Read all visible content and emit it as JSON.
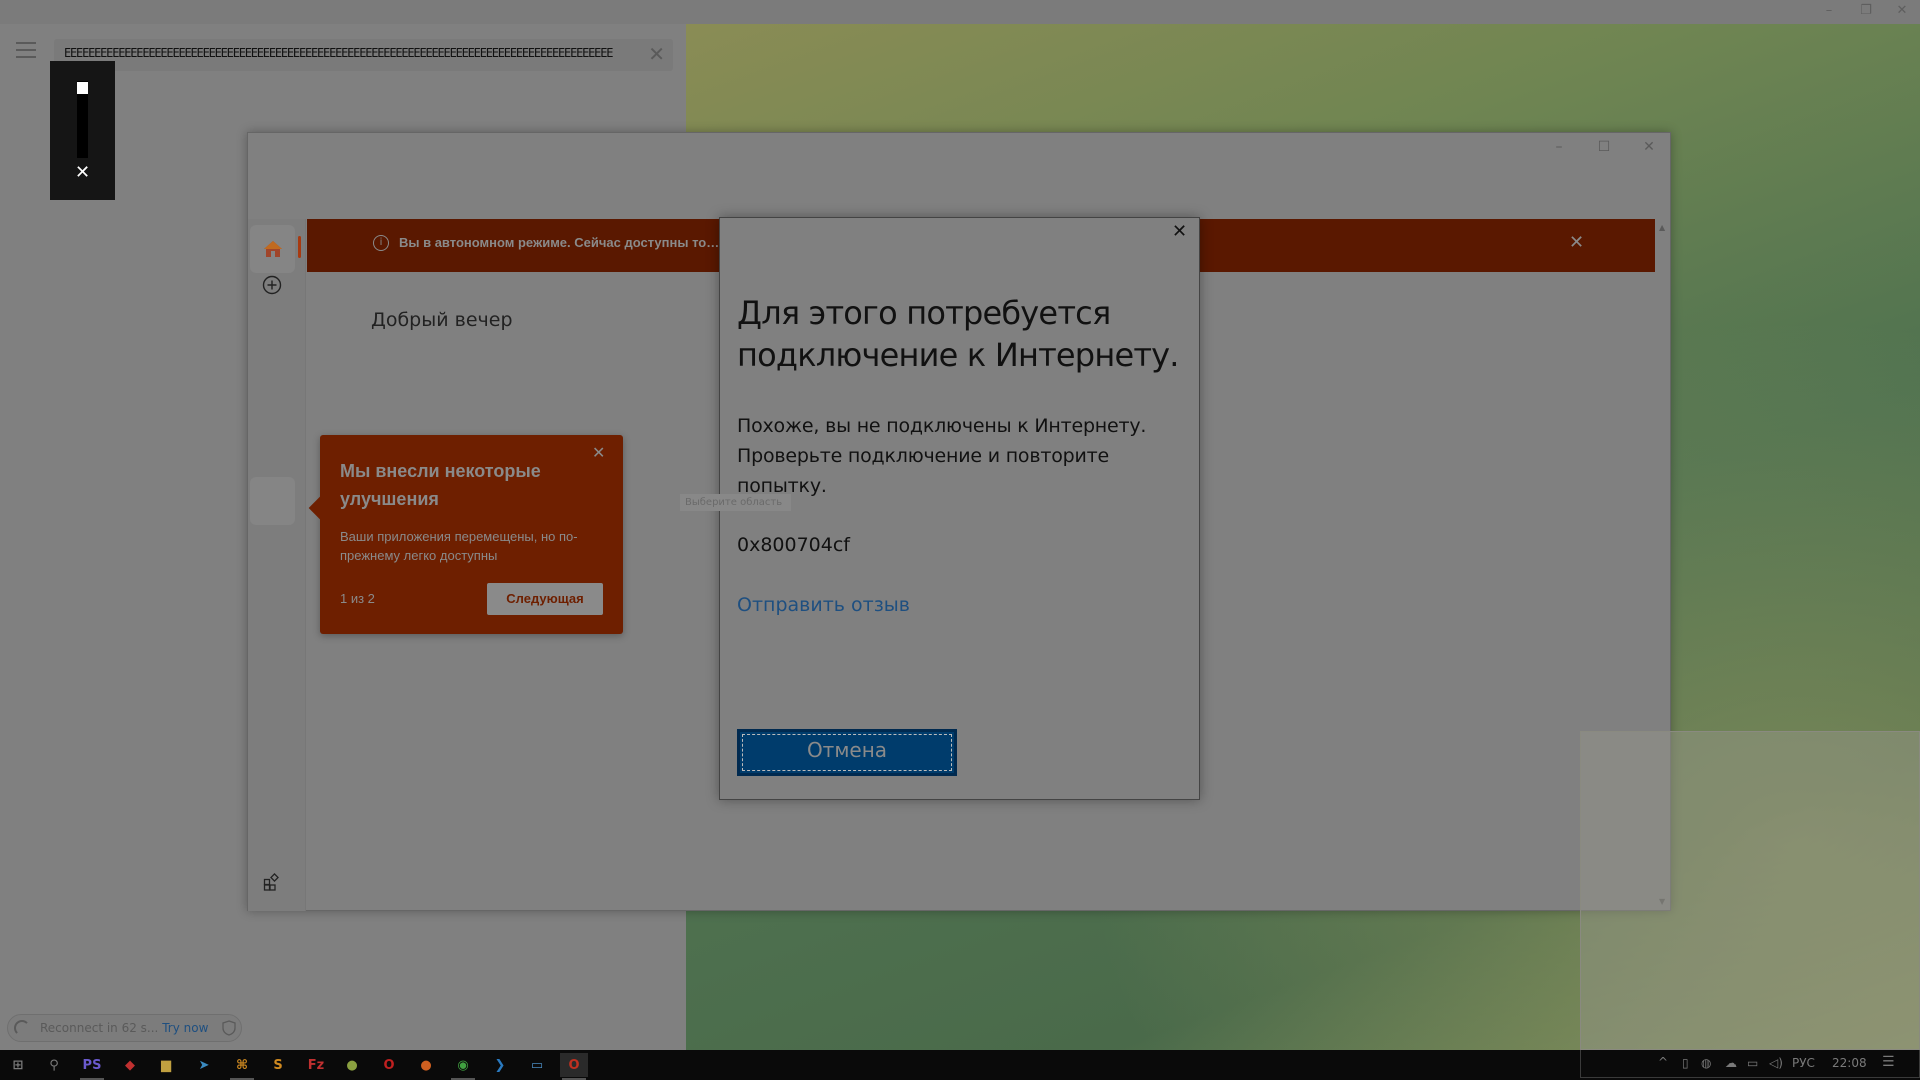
{
  "topbar": {
    "minimize": "–",
    "restore": "❐",
    "close": "✕"
  },
  "left_panel": {
    "search": {
      "value": "EEEEEEEEEEEEEEEEEEEEEEEEEEEEEEEEEEEEEEEEEEEEEEEEEEEEEEEEEEEEEEEEEEEEEEEEEEEEEEEEEEEEEEEEEEE",
      "clear": "✕"
    },
    "overlay_close": "✕",
    "reconnect": {
      "text": "Reconnect in 62 s...",
      "action": "Try now"
    }
  },
  "app_window": {
    "controls": {
      "minimize": "–",
      "maximize": "☐",
      "close": "✕"
    },
    "banner": {
      "text": "Вы в автономном режиме. Сейчас доступны то…                                                                                                       компьютере.",
      "info": "i",
      "close": "✕"
    },
    "greeting": "Добрый вечер",
    "scroll": {
      "up": "▲",
      "down": "▼"
    },
    "tooltip": {
      "title": "Мы внесли некоторые улучшения",
      "body": "Ваши приложения перемещены, но по-прежнему легко доступны",
      "counter": "1 из 2",
      "next": "Следующая",
      "close": "✕"
    },
    "accent": "#5a1800"
  },
  "area_hint": "Выберите область",
  "dialog": {
    "close": "✕",
    "title": "Для этого потребуется подключение к Интернету.",
    "body": "Похоже, вы не подключены к Интернету. Проверьте подключение и повторите попытку.",
    "error_code": "0x800704cf",
    "feedback_link": "Отправить отзыв",
    "cancel": "Отмена"
  },
  "taskbar": {
    "apps": [
      {
        "name": "start",
        "glyph": "⊞",
        "color": "#7a7a7a"
      },
      {
        "name": "search",
        "glyph": "⚲",
        "color": "#7a7a7a"
      },
      {
        "name": "phpstorm",
        "glyph": "PS",
        "color": "#6a5acd"
      },
      {
        "name": "anydesk",
        "glyph": "◆",
        "color": "#c03030"
      },
      {
        "name": "file-explorer",
        "glyph": "▆",
        "color": "#c0a040"
      },
      {
        "name": "telegram",
        "glyph": "➤",
        "color": "#3a8ac0"
      },
      {
        "name": "app-network",
        "glyph": "⌘",
        "color": "#d08a20"
      },
      {
        "name": "sublime",
        "glyph": "S",
        "color": "#d08a20"
      },
      {
        "name": "filezilla",
        "glyph": "Fz",
        "color": "#c03030"
      },
      {
        "name": "rainbow-app",
        "glyph": "●",
        "color": "#8aa040"
      },
      {
        "name": "opera",
        "glyph": "O",
        "color": "#c02020"
      },
      {
        "name": "firefox",
        "glyph": "●",
        "color": "#d06020"
      },
      {
        "name": "chrome",
        "glyph": "◉",
        "color": "#40a040"
      },
      {
        "name": "vscode",
        "glyph": "❯",
        "color": "#2a7ac0"
      },
      {
        "name": "app-window",
        "glyph": "▭",
        "color": "#4a8ac0"
      },
      {
        "name": "office",
        "glyph": "O",
        "color": "#c03020"
      }
    ],
    "tray": {
      "chevron": "^",
      "language": "РУС",
      "time": "22:08",
      "notifications": "☰"
    }
  }
}
